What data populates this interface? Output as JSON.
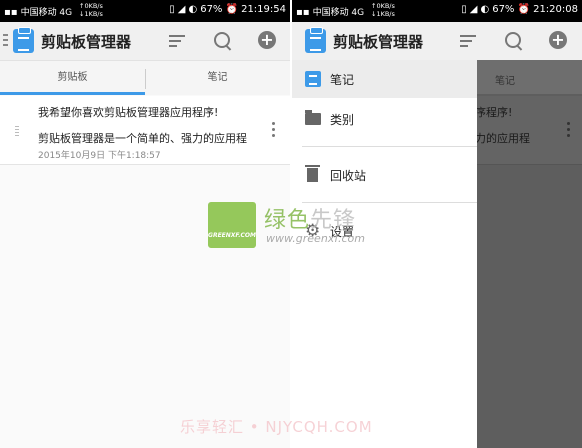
{
  "status_left": {
    "carrier": "中国移动 4G",
    "speed_up": "↑0KB/s",
    "speed_down": "↓1KB/s",
    "battery": "67%",
    "time": "21:19:54"
  },
  "status_right": {
    "carrier": "中国移动 4G",
    "speed_up": "↑0KB/s",
    "speed_down": "↓1KB/s",
    "battery": "67%",
    "time": "21:20:08"
  },
  "app": {
    "title": "剪贴板管理器",
    "icons": [
      "menu-icon",
      "clipboard-icon",
      "sort-icon",
      "search-icon",
      "add-icon"
    ]
  },
  "tabs": {
    "clipboard": "剪贴板",
    "notes": "笔记"
  },
  "clip": {
    "line1": "我希望你喜欢剪贴板管理器应用程序!",
    "line2": "剪贴板管理器是一个简单的、强力的应用程",
    "date": "2015年10月9日 下午1:18:57"
  },
  "drawer": {
    "items": [
      {
        "label": "笔记",
        "icon": "note-icon"
      },
      {
        "label": "类别",
        "icon": "folder-icon"
      },
      {
        "label": "回收站",
        "icon": "trash-icon"
      },
      {
        "label": "设置",
        "icon": "gear-icon"
      }
    ]
  },
  "dimmed": {
    "tab": "笔记",
    "line1": "序程序!",
    "line2": "力的应用程"
  },
  "watermark": {
    "cn_part1": "绿色",
    "cn_part2": "先锋",
    "badge": "GREENXF.COM",
    "url": "www.greenxf.com",
    "bottom": "乐享轻汇 • NJYCQH.COM"
  },
  "colors": {
    "accent": "#3d9ae8",
    "status_bar": "#000000",
    "scrim": "#5e5e5e"
  }
}
